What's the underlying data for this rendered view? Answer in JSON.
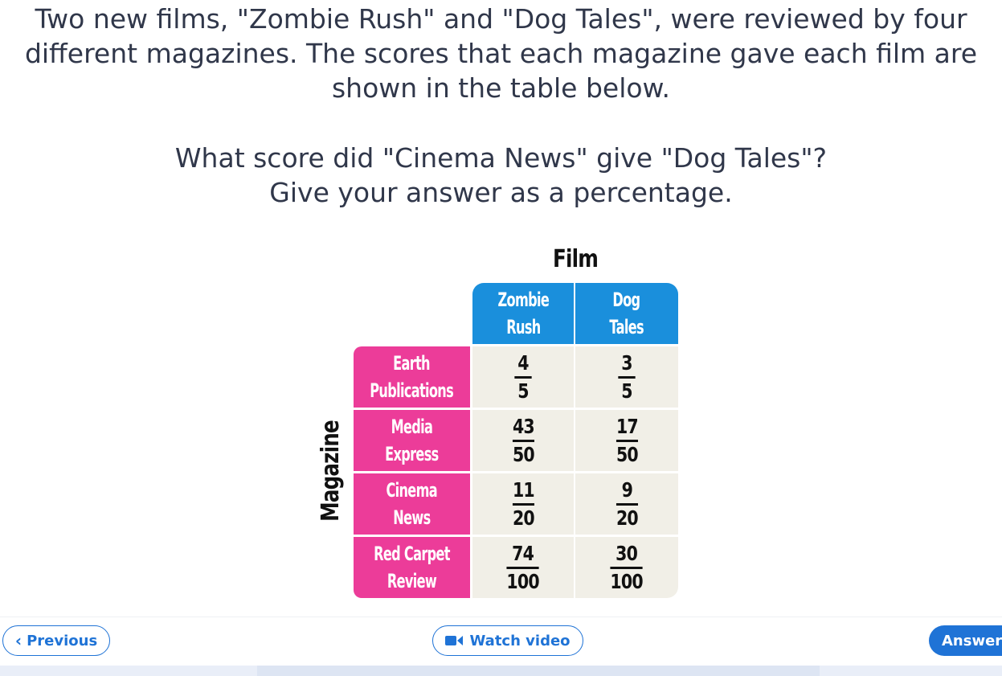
{
  "question": {
    "lines": [
      "Two new films, \"Zombie Rush\" and \"Dog Tales\", were reviewed by four",
      "different magazines. The scores that each magazine gave each film are",
      "shown in the table below.",
      "What score did \"Cinema News\" give \"Dog Tales\"?",
      "Give your answer as a percentage."
    ]
  },
  "table": {
    "col_group_title": "Film",
    "row_group_title": "Magazine",
    "columns": [
      {
        "line1": "Zombie",
        "line2": "Rush"
      },
      {
        "line1": "Dog",
        "line2": "Tales"
      }
    ],
    "rows": [
      {
        "line1": "Earth",
        "line2": "Publications",
        "scores": [
          {
            "num": "4",
            "den": "5"
          },
          {
            "num": "3",
            "den": "5"
          }
        ]
      },
      {
        "line1": "Media",
        "line2": "Express",
        "scores": [
          {
            "num": "43",
            "den": "50"
          },
          {
            "num": "17",
            "den": "50"
          }
        ]
      },
      {
        "line1": "Cinema",
        "line2": "News",
        "scores": [
          {
            "num": "11",
            "den": "20"
          },
          {
            "num": "9",
            "den": "20"
          }
        ]
      },
      {
        "line1": "Red Carpet",
        "line2": "Review",
        "scores": [
          {
            "num": "74",
            "den": "100"
          },
          {
            "num": "30",
            "den": "100"
          }
        ]
      }
    ],
    "colors": {
      "column_header": "#1a8fdc",
      "row_header": "#ec3c99",
      "cell": "#f1efe7"
    }
  },
  "footer": {
    "previous_label": "Previous",
    "video_label": "Watch video",
    "answer_label": "Answer",
    "previous_icon": "chevron-left-icon",
    "video_icon": "video-camera-icon",
    "accent_color": "#1f73d6"
  }
}
